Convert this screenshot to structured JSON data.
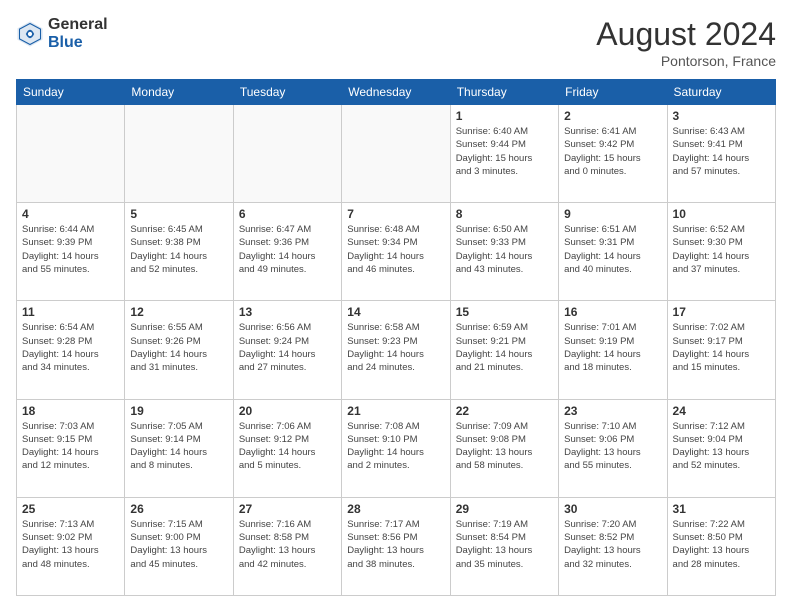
{
  "header": {
    "logo_general": "General",
    "logo_blue": "Blue",
    "month_title": "August 2024",
    "location": "Pontorson, France"
  },
  "days_of_week": [
    "Sunday",
    "Monday",
    "Tuesday",
    "Wednesday",
    "Thursday",
    "Friday",
    "Saturday"
  ],
  "weeks": [
    [
      {
        "day": "",
        "info": ""
      },
      {
        "day": "",
        "info": ""
      },
      {
        "day": "",
        "info": ""
      },
      {
        "day": "",
        "info": ""
      },
      {
        "day": "1",
        "info": "Sunrise: 6:40 AM\nSunset: 9:44 PM\nDaylight: 15 hours\nand 3 minutes."
      },
      {
        "day": "2",
        "info": "Sunrise: 6:41 AM\nSunset: 9:42 PM\nDaylight: 15 hours\nand 0 minutes."
      },
      {
        "day": "3",
        "info": "Sunrise: 6:43 AM\nSunset: 9:41 PM\nDaylight: 14 hours\nand 57 minutes."
      }
    ],
    [
      {
        "day": "4",
        "info": "Sunrise: 6:44 AM\nSunset: 9:39 PM\nDaylight: 14 hours\nand 55 minutes."
      },
      {
        "day": "5",
        "info": "Sunrise: 6:45 AM\nSunset: 9:38 PM\nDaylight: 14 hours\nand 52 minutes."
      },
      {
        "day": "6",
        "info": "Sunrise: 6:47 AM\nSunset: 9:36 PM\nDaylight: 14 hours\nand 49 minutes."
      },
      {
        "day": "7",
        "info": "Sunrise: 6:48 AM\nSunset: 9:34 PM\nDaylight: 14 hours\nand 46 minutes."
      },
      {
        "day": "8",
        "info": "Sunrise: 6:50 AM\nSunset: 9:33 PM\nDaylight: 14 hours\nand 43 minutes."
      },
      {
        "day": "9",
        "info": "Sunrise: 6:51 AM\nSunset: 9:31 PM\nDaylight: 14 hours\nand 40 minutes."
      },
      {
        "day": "10",
        "info": "Sunrise: 6:52 AM\nSunset: 9:30 PM\nDaylight: 14 hours\nand 37 minutes."
      }
    ],
    [
      {
        "day": "11",
        "info": "Sunrise: 6:54 AM\nSunset: 9:28 PM\nDaylight: 14 hours\nand 34 minutes."
      },
      {
        "day": "12",
        "info": "Sunrise: 6:55 AM\nSunset: 9:26 PM\nDaylight: 14 hours\nand 31 minutes."
      },
      {
        "day": "13",
        "info": "Sunrise: 6:56 AM\nSunset: 9:24 PM\nDaylight: 14 hours\nand 27 minutes."
      },
      {
        "day": "14",
        "info": "Sunrise: 6:58 AM\nSunset: 9:23 PM\nDaylight: 14 hours\nand 24 minutes."
      },
      {
        "day": "15",
        "info": "Sunrise: 6:59 AM\nSunset: 9:21 PM\nDaylight: 14 hours\nand 21 minutes."
      },
      {
        "day": "16",
        "info": "Sunrise: 7:01 AM\nSunset: 9:19 PM\nDaylight: 14 hours\nand 18 minutes."
      },
      {
        "day": "17",
        "info": "Sunrise: 7:02 AM\nSunset: 9:17 PM\nDaylight: 14 hours\nand 15 minutes."
      }
    ],
    [
      {
        "day": "18",
        "info": "Sunrise: 7:03 AM\nSunset: 9:15 PM\nDaylight: 14 hours\nand 12 minutes."
      },
      {
        "day": "19",
        "info": "Sunrise: 7:05 AM\nSunset: 9:14 PM\nDaylight: 14 hours\nand 8 minutes."
      },
      {
        "day": "20",
        "info": "Sunrise: 7:06 AM\nSunset: 9:12 PM\nDaylight: 14 hours\nand 5 minutes."
      },
      {
        "day": "21",
        "info": "Sunrise: 7:08 AM\nSunset: 9:10 PM\nDaylight: 14 hours\nand 2 minutes."
      },
      {
        "day": "22",
        "info": "Sunrise: 7:09 AM\nSunset: 9:08 PM\nDaylight: 13 hours\nand 58 minutes."
      },
      {
        "day": "23",
        "info": "Sunrise: 7:10 AM\nSunset: 9:06 PM\nDaylight: 13 hours\nand 55 minutes."
      },
      {
        "day": "24",
        "info": "Sunrise: 7:12 AM\nSunset: 9:04 PM\nDaylight: 13 hours\nand 52 minutes."
      }
    ],
    [
      {
        "day": "25",
        "info": "Sunrise: 7:13 AM\nSunset: 9:02 PM\nDaylight: 13 hours\nand 48 minutes."
      },
      {
        "day": "26",
        "info": "Sunrise: 7:15 AM\nSunset: 9:00 PM\nDaylight: 13 hours\nand 45 minutes."
      },
      {
        "day": "27",
        "info": "Sunrise: 7:16 AM\nSunset: 8:58 PM\nDaylight: 13 hours\nand 42 minutes."
      },
      {
        "day": "28",
        "info": "Sunrise: 7:17 AM\nSunset: 8:56 PM\nDaylight: 13 hours\nand 38 minutes."
      },
      {
        "day": "29",
        "info": "Sunrise: 7:19 AM\nSunset: 8:54 PM\nDaylight: 13 hours\nand 35 minutes."
      },
      {
        "day": "30",
        "info": "Sunrise: 7:20 AM\nSunset: 8:52 PM\nDaylight: 13 hours\nand 32 minutes."
      },
      {
        "day": "31",
        "info": "Sunrise: 7:22 AM\nSunset: 8:50 PM\nDaylight: 13 hours\nand 28 minutes."
      }
    ]
  ]
}
